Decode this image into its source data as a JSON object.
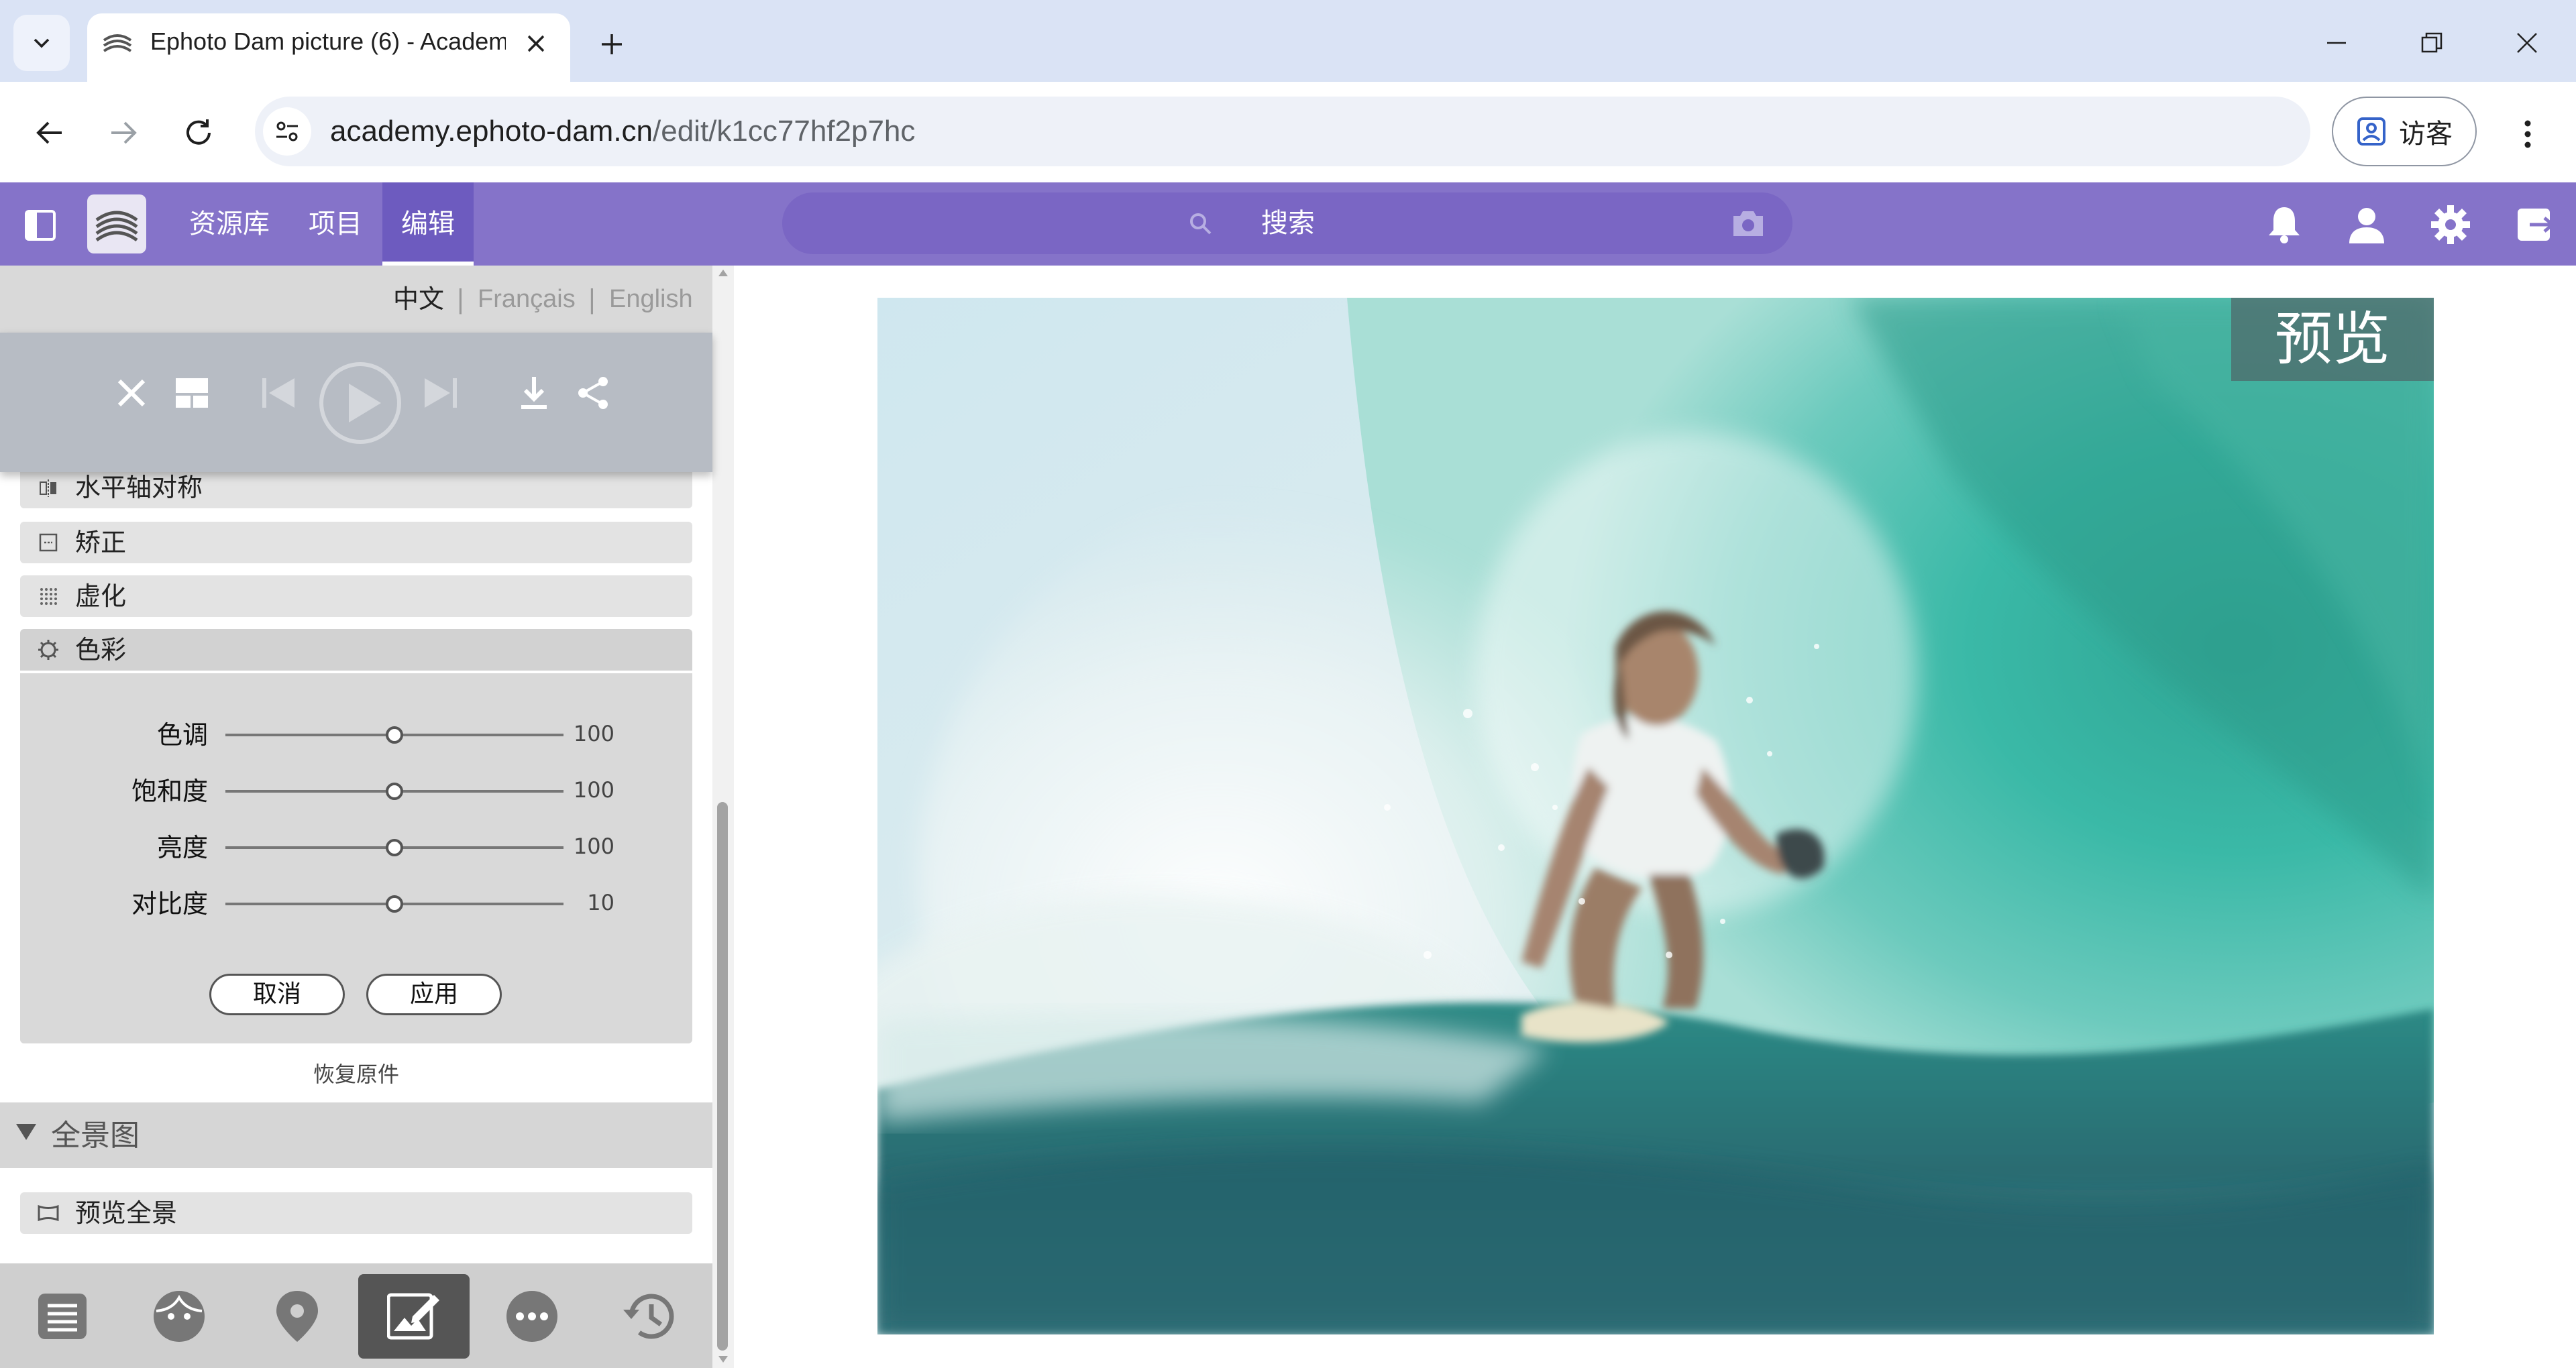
{
  "browser": {
    "tab_title": "Ephoto Dam picture (6) - Academy",
    "url_host": "academy.ephoto-dam.cn",
    "url_path": "/edit/k1cc77hf2p7hc",
    "profile_label": "访客"
  },
  "app": {
    "nav": [
      {
        "label": "资源库"
      },
      {
        "label": "项目"
      },
      {
        "label": "编辑"
      }
    ],
    "search_placeholder": "搜索",
    "accent_color": "#8573c9"
  },
  "languages": {
    "zh": "中文",
    "fr": "Français",
    "en": "English",
    "separator": "|"
  },
  "tools": {
    "flip_horizontal": "水平轴对称",
    "straighten": "矫正",
    "blur": "虚化",
    "color": "色彩"
  },
  "color_panel": {
    "sliders": [
      {
        "label": "色调",
        "value": "100",
        "position": 0.5
      },
      {
        "label": "饱和度",
        "value": "100",
        "position": 0.5
      },
      {
        "label": "亮度",
        "value": "100",
        "position": 0.5
      },
      {
        "label": "对比度",
        "value": "10",
        "position": 0.5
      }
    ],
    "cancel": "取消",
    "apply": "应用",
    "restore": "恢复原件"
  },
  "panorama": {
    "title": "全景图",
    "preview": "预览全景"
  },
  "preview_badge": "预览"
}
